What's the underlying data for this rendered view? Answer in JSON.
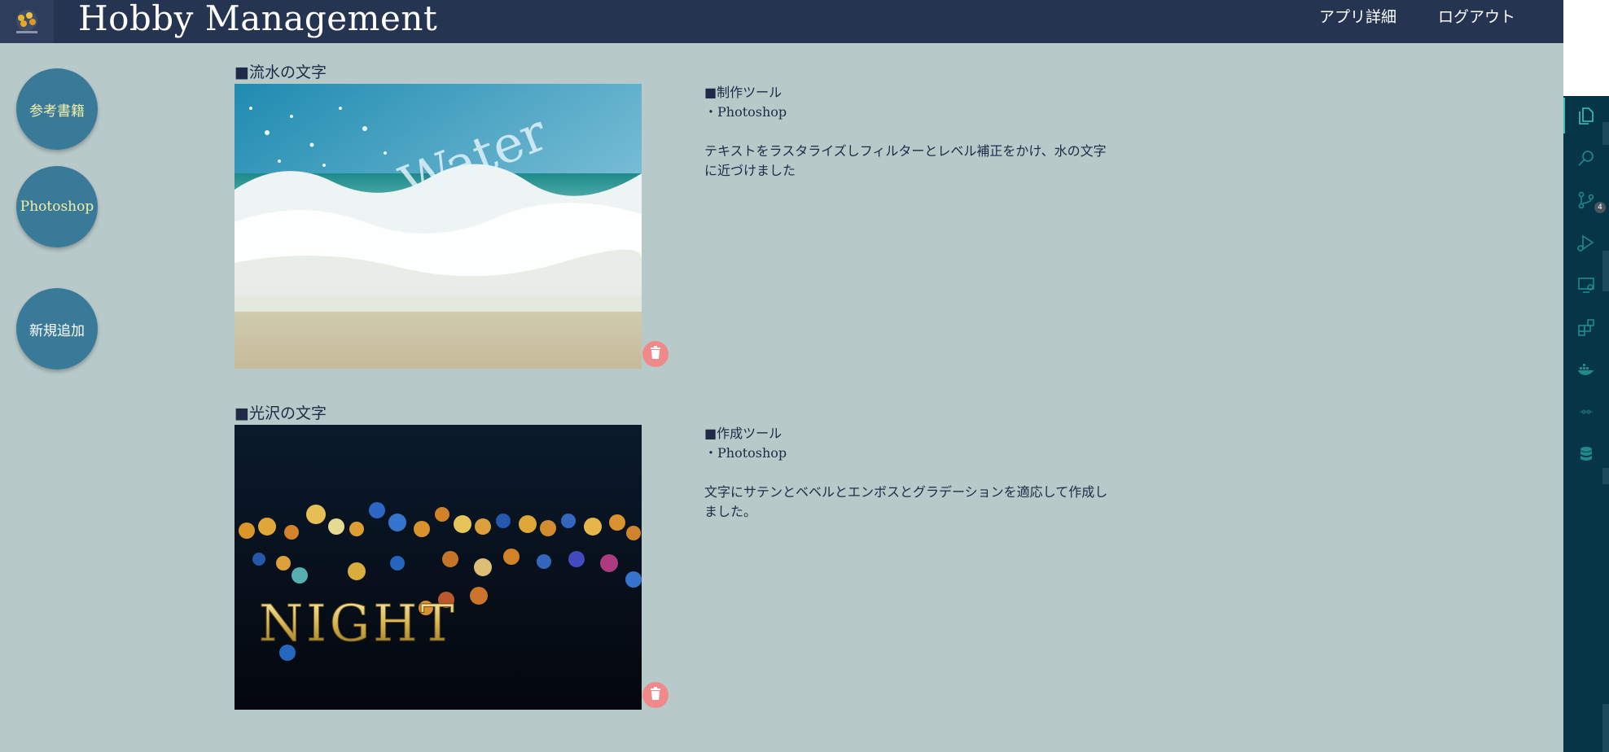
{
  "header": {
    "title": "Hobby Management",
    "nav": {
      "app_detail": "アプリ詳細",
      "logout": "ログアウト"
    }
  },
  "sidebar": {
    "buttons": [
      {
        "label": "参考書籍"
      },
      {
        "label": "Photoshop"
      },
      {
        "label": "新規追加"
      }
    ]
  },
  "items": [
    {
      "title": "■流水の文字",
      "image_text": "Water",
      "tools_heading": "■制作ツール",
      "tool": "・Photoshop",
      "description_line1": "テキストをラスタライズしフィルターとレベル補正をかけ、水の文字",
      "description_line2": "に近づけました"
    },
    {
      "title": "■光沢の文字",
      "image_text": "NIGHT",
      "tools_heading": "■作成ツール",
      "tool": "・Photoshop",
      "description_line1": "文字にサテンとベベルとエンボスとグラデーションを適応して作成し",
      "description_line2": "ました。"
    }
  ],
  "activity_bar": {
    "icons": [
      "explorer-icon",
      "search-icon",
      "source-control-icon",
      "run-debug-icon",
      "remote-explorer-icon",
      "extensions-icon",
      "docker-icon",
      "gitlens-icon",
      "database-icon"
    ],
    "source_control_badge": "4"
  },
  "colors": {
    "header_bg": "#253451",
    "page_bg": "#b8c9c9",
    "button_bg": "#3a7a99",
    "delete_bg": "#f08a8a",
    "activity_bar_bg": "#063548",
    "activity_accent": "#39c6b5"
  }
}
